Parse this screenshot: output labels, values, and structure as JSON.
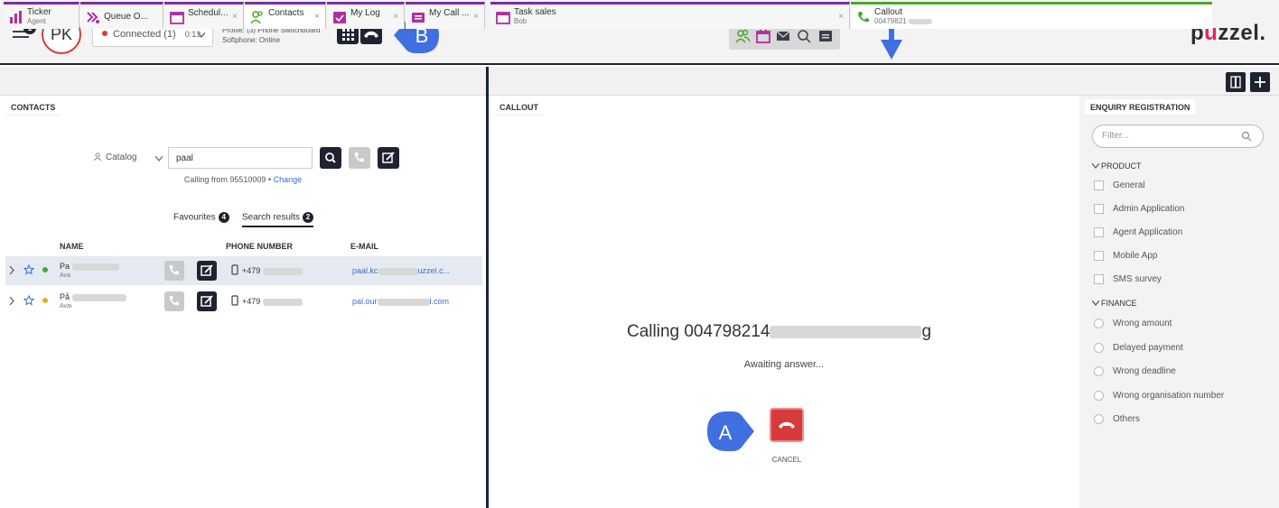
{
  "header": {
    "menu_badge": "1",
    "avatar_initials": "PK",
    "status": "Connected (1)",
    "timer": "0:13",
    "profile_line1": "Profile: (3) Phone Switchboard",
    "profile_line2": "Softphone: Online",
    "callout_b": "B",
    "logo_pre": "p",
    "logo_u": "u",
    "logo_post": "zzel."
  },
  "tabs_left": [
    {
      "title": "Ticker",
      "sub": "Agent"
    },
    {
      "title": "Queue O..."
    },
    {
      "title": "Schedul...",
      "close": "×"
    },
    {
      "title": "Contacts",
      "close": "×"
    },
    {
      "title": "My Log",
      "close": "×"
    },
    {
      "title": "My Call ...",
      "close": "×"
    }
  ],
  "tabs_right": [
    {
      "title": "Task sales",
      "sub": "Bob",
      "close": "×"
    },
    {
      "title": "Callout",
      "sub": "00479821"
    }
  ],
  "contacts": {
    "section": "CONTACTS",
    "catalog_label": "Catalog",
    "search_value": "paal",
    "calling_from": "Calling from 95510009 •",
    "change_link": "Change",
    "favourites_label": "Favourites",
    "favourites_count": "4",
    "search_results_label": "Search results",
    "search_results_count": "2",
    "col_name": "NAME",
    "col_phone": "PHONE NUMBER",
    "col_email": "E-MAIL",
    "rows": [
      {
        "name": "Pa",
        "status": "Ava",
        "phone": "+479",
        "email_pre": "paal.kc",
        "email_post": "uzzel.c..."
      },
      {
        "name": "På",
        "status": "Avai",
        "phone": "+479",
        "email_pre": "pal.our",
        "email_post": "l.com"
      }
    ]
  },
  "callout": {
    "section": "CALLOUT",
    "calling_prefix": "Calling 004798214",
    "calling_suffix": "g",
    "awaiting": "Awaiting answer...",
    "cancel": "CANCEL",
    "callout_a": "A"
  },
  "enquiry": {
    "section": "ENQUIRY REGISTRATION",
    "filter_placeholder": "Filter...",
    "product_label": "PRODUCT",
    "product_options": [
      "General",
      "Admin Application",
      "Agent Application",
      "Mobile App",
      "SMS survey"
    ],
    "finance_label": "FINANCE",
    "finance_options": [
      "Wrong amount",
      "Delayed payment",
      "Wrong deadline",
      "Wrong organisation number",
      "Others"
    ]
  },
  "colors": {
    "accent_dark": "#1d2330",
    "tab_purple": "#7b2fa2",
    "callout_green": "#49a72a",
    "cancel_red": "#d73a3a",
    "link_blue": "#2f6fd6",
    "callout_blue": "#3f6fe0"
  },
  "icons": [
    "menu-icon",
    "dialpad-icon",
    "hangup-icon",
    "contacts-icon",
    "calendar-icon",
    "mail-icon",
    "search-icon",
    "chat-icon",
    "ticker-icon",
    "queue-icon",
    "phone-icon",
    "edit-icon",
    "star-icon",
    "mobile-icon",
    "chevron-right-icon",
    "chevron-down-icon",
    "split-view-icon",
    "plus-icon"
  ]
}
